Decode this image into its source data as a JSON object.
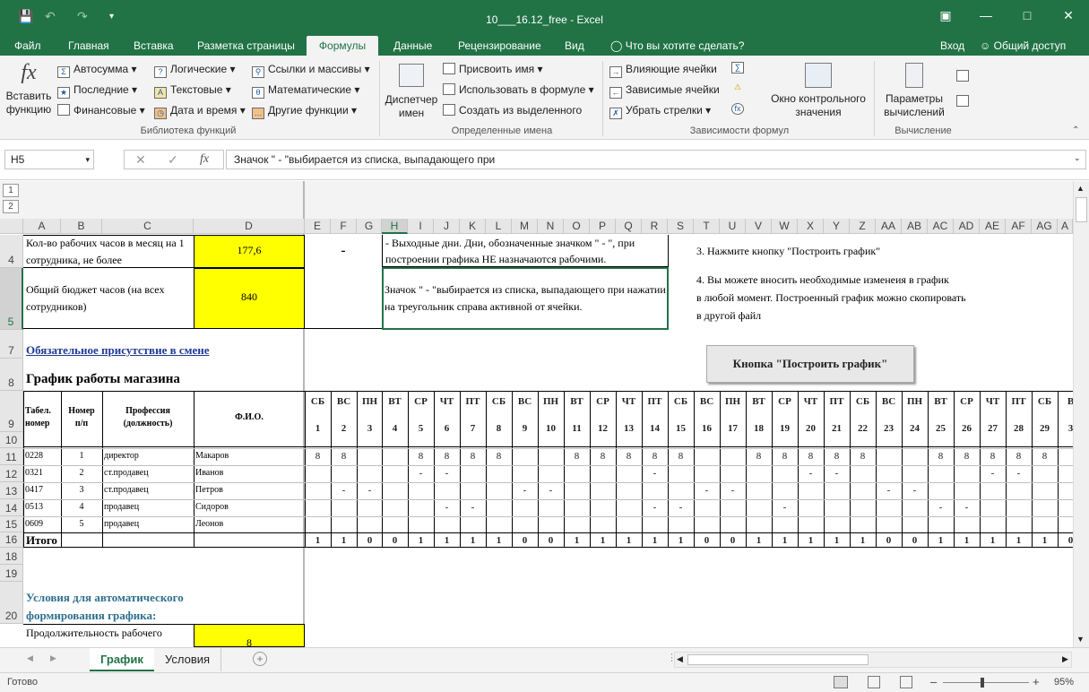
{
  "window": {
    "title": "10___16.12_free - Excel"
  },
  "tabs": [
    "Файл",
    "Главная",
    "Вставка",
    "Разметка страницы",
    "Формулы",
    "Данные",
    "Рецензирование",
    "Вид"
  ],
  "tell_me": "Что вы хотите сделать?",
  "login": "Вход",
  "share": "Общий доступ",
  "ribbon": {
    "insert_function": "Вставить функцию",
    "autosum": "Автосумма",
    "recent": "Последние",
    "financial": "Финансовые",
    "logical": "Логические",
    "text": "Текстовые",
    "datetime": "Дата и время",
    "lookup": "Ссылки и массивы",
    "math": "Математические",
    "other": "Другие функции",
    "group_library": "Библиотека функций",
    "name_manager": "Диспетчер имен",
    "assign_name": "Присвоить имя",
    "use_in_formula": "Использовать в формуле",
    "create_from_selection": "Создать из выделенного",
    "group_names": "Определенные имена",
    "trace_precedents": "Влияющие ячейки",
    "trace_dependents": "Зависимые ячейки",
    "remove_arrows": "Убрать стрелки",
    "watch_window": "Окно контрольного значения",
    "group_audit": "Зависимости формул",
    "calc_options": "Параметры вычислений",
    "group_calc": "Вычисление"
  },
  "formula_bar": {
    "name_box": "H5",
    "content": "Значок \" - \"выбирается из списка, выпадающего при"
  },
  "col_headers": [
    "A",
    "B",
    "C",
    "D",
    "E",
    "F",
    "G",
    "H",
    "I",
    "J",
    "K",
    "L",
    "M",
    "N",
    "O",
    "P",
    "Q",
    "R",
    "S",
    "T",
    "U",
    "V",
    "W",
    "X",
    "Y",
    "Z",
    "AA",
    "AB",
    "AC",
    "AD",
    "AE",
    "AF",
    "AG",
    "A"
  ],
  "row_headers": [
    "4",
    "5",
    "7",
    "8",
    "9",
    "10",
    "11",
    "12",
    "13",
    "14",
    "15",
    "16",
    "18",
    "19",
    "20"
  ],
  "sheet": {
    "r4_label": "Кол-во рабочих часов в месяц на 1 сотрудника, не более",
    "r4_value": "177,6",
    "r5_label": "Общий бюджет часов (на всех сотрудников)",
    "r5_value": "840",
    "dash": "-",
    "note1": "- Выходные дни. Дни, обозначенные значком \" - \", при построении графика НЕ назначаются рабочими.",
    "note2": "Значок \" - \"выбирается из списка, выпадающего при нажатии на треугольник справа активной от ячейки.",
    "step3": "3. Нажмите кнопку \"Построить график\"",
    "step4_l1": "4. Вы можете вносить необходимые изменеия в график",
    "step4_l2": "в любой момент. Построенный график можно скопировать",
    "step4_l3": "в другой файл",
    "required": "Обязательное присутствие в смене",
    "schedule_title": "График работы магазина",
    "build_button": "Кнопка \"Построить график\"",
    "hdr_tab": "Табел. номер",
    "hdr_num": "Номер п/п",
    "hdr_prof": "Профессия (должность)",
    "hdr_fio": "Ф.И.О.",
    "total_label": "Итого",
    "conditions": "Условия для автоматического формирования графика:",
    "duration": "Продолжительность рабочего",
    "duration_value": "8"
  },
  "days": [
    "СБ",
    "ВС",
    "ПН",
    "ВТ",
    "СР",
    "ЧТ",
    "ПТ",
    "СБ",
    "ВС",
    "ПН",
    "ВТ",
    "СР",
    "ЧТ",
    "ПТ",
    "СБ",
    "ВС",
    "ПН",
    "ВТ",
    "СР",
    "ЧТ",
    "ПТ",
    "СБ",
    "ВС",
    "ПН",
    "ВТ",
    "СР",
    "ЧТ",
    "ПТ",
    "СБ",
    "В"
  ],
  "day_nums": [
    "1",
    "2",
    "3",
    "4",
    "5",
    "6",
    "7",
    "8",
    "9",
    "10",
    "11",
    "12",
    "13",
    "14",
    "15",
    "16",
    "17",
    "18",
    "19",
    "20",
    "21",
    "22",
    "23",
    "24",
    "25",
    "26",
    "27",
    "28",
    "29",
    "3"
  ],
  "employees": [
    {
      "tab": "0228",
      "num": "1",
      "prof": "директор",
      "fio": "Макаров",
      "cells": [
        "8",
        "8",
        "",
        "",
        "8",
        "8",
        "8",
        "8",
        "",
        "",
        "8",
        "8",
        "8",
        "8",
        "8",
        "",
        "",
        "8",
        "8",
        "8",
        "8",
        "8",
        "",
        "",
        "8",
        "8",
        "8",
        "8",
        "8",
        ""
      ]
    },
    {
      "tab": "0321",
      "num": "2",
      "prof": "ст.продавец",
      "fio": "Иванов",
      "cells": [
        "",
        "",
        "",
        "",
        "-",
        "-",
        "",
        "",
        "",
        "",
        "",
        "",
        "",
        "-",
        "",
        "",
        "",
        "",
        "",
        "-",
        "-",
        "",
        "",
        "",
        "",
        "",
        "-",
        "-",
        "",
        ""
      ]
    },
    {
      "tab": "0417",
      "num": "3",
      "prof": "ст.продавец",
      "fio": "Петров",
      "cells": [
        "",
        "-",
        "-",
        "",
        "",
        "",
        "",
        "",
        "-",
        "-",
        "",
        "",
        "",
        "",
        "",
        "-",
        "-",
        "",
        "",
        "",
        "",
        "",
        "-",
        "-",
        "",
        "",
        "",
        "",
        "",
        ""
      ]
    },
    {
      "tab": "0513",
      "num": "4",
      "prof": "продавец",
      "fio": "Сидоров",
      "cells": [
        "",
        "",
        "",
        "",
        "",
        "-",
        "-",
        "",
        "",
        "",
        "",
        "",
        "",
        "-",
        "-",
        "",
        "",
        "",
        "-",
        "",
        "",
        "",
        "",
        "",
        "-",
        "-",
        "",
        "",
        "",
        ""
      ]
    },
    {
      "tab": "0609",
      "num": "5",
      "prof": "продавец",
      "fio": "Леонов",
      "cells": [
        "",
        "",
        "",
        "",
        "",
        "",
        "",
        "",
        "",
        "",
        "",
        "",
        "",
        "",
        "",
        "",
        "",
        "",
        "",
        "",
        "",
        "",
        "",
        "",
        "",
        "",
        "",
        "",
        "",
        ""
      ]
    }
  ],
  "totals": [
    "1",
    "1",
    "0",
    "0",
    "1",
    "1",
    "1",
    "1",
    "0",
    "0",
    "1",
    "1",
    "1",
    "1",
    "1",
    "0",
    "0",
    "1",
    "1",
    "1",
    "1",
    "1",
    "0",
    "0",
    "1",
    "1",
    "1",
    "1",
    "1",
    "0"
  ],
  "sheets": [
    "График",
    "Условия"
  ],
  "status": {
    "ready": "Готово",
    "zoom": "95%"
  }
}
